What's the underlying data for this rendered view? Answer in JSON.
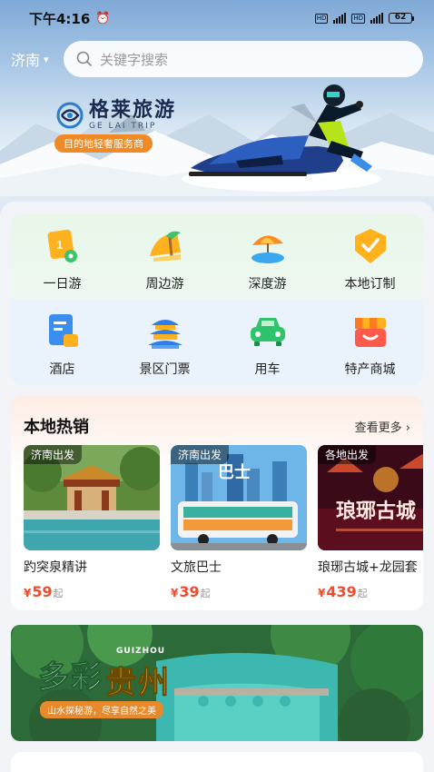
{
  "status_bar": {
    "time": "下午4:16",
    "battery": "62"
  },
  "header": {
    "city": "济南",
    "search_placeholder": "关键字搜索"
  },
  "hero": {
    "brand_name": "格莱旅游",
    "brand_en": "GE LAI TRIP",
    "brand_tagline": "目的地轻奢服务商"
  },
  "categories": [
    {
      "label": "一日游",
      "icon": "flag-icon"
    },
    {
      "label": "周边游",
      "icon": "palm-icon"
    },
    {
      "label": "深度游",
      "icon": "umbrella-icon"
    },
    {
      "label": "本地订制",
      "icon": "badge-icon"
    },
    {
      "label": "酒店",
      "icon": "hotel-icon"
    },
    {
      "label": "景区门票",
      "icon": "temple-icon"
    },
    {
      "label": "用车",
      "icon": "car-icon"
    },
    {
      "label": "特产商城",
      "icon": "shop-icon"
    }
  ],
  "hot_section": {
    "title_plain": "本地",
    "title_accent": "热销",
    "more_label": "查看更多",
    "cards": [
      {
        "tag": "济南出发",
        "name": "趵突泉精讲",
        "currency": "¥",
        "price": "59",
        "suffix": "起"
      },
      {
        "tag": "济南出发",
        "name": "文旅巴士",
        "currency": "¥",
        "price": "39",
        "suffix": "起"
      },
      {
        "tag": "各地出发",
        "name": "琅琊古城+龙园套",
        "currency": "¥",
        "price": "439",
        "suffix": "起"
      }
    ]
  },
  "banner": {
    "title_part1": "多彩",
    "title_part2": "贵州",
    "title_en": "GUIZHOU",
    "subtitle": "山水探秘游，尽享自然之美"
  },
  "colors": {
    "price": "#f24a2b",
    "accent_orange": "#f08a24",
    "brand_navy": "#1a2b4f"
  }
}
